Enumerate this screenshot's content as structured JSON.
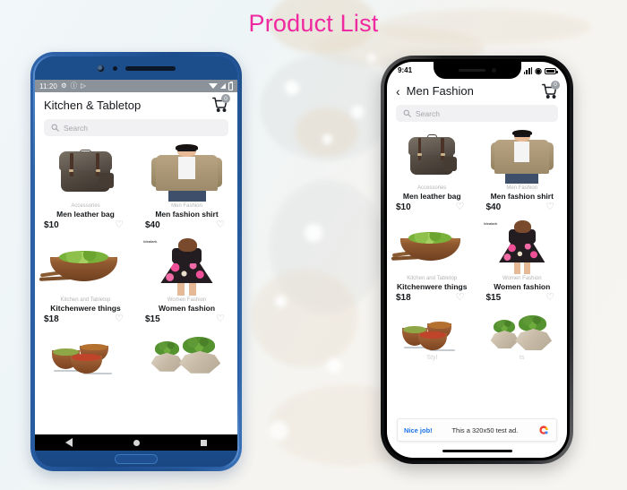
{
  "page": {
    "title": "Product List",
    "title_color": "#ef29a0"
  },
  "android": {
    "status_bar": {
      "time": "11:20",
      "icons": [
        "gear-icon",
        "info-icon",
        "play-icon"
      ],
      "right_icons": [
        "wifi-icon",
        "signal-icon",
        "battery-icon"
      ]
    },
    "app_bar": {
      "title": "Kitchen & Tabletop",
      "cart_icon": "shopping-cart-icon",
      "cart_badge": "0"
    },
    "search": {
      "placeholder": "Search",
      "icon": "search-icon"
    },
    "products": [
      {
        "category": "Accessories",
        "name": "Men leather bag",
        "price": "$10",
        "favorite_icon": "heart-outline-icon",
        "image": "leather-backpack"
      },
      {
        "category": "Men Fashion",
        "name": "Men fashion shirt",
        "price": "$40",
        "favorite_icon": "heart-outline-icon",
        "image": "man-in-khaki-shirt"
      },
      {
        "category": "Kitchen and Tabletop",
        "name": "Kitchenwere things",
        "price": "$18",
        "favorite_icon": "heart-outline-icon",
        "image": "wooden-salad-bowl"
      },
      {
        "category": "Women Fashion",
        "name": "Women fashion",
        "price": "$15",
        "favorite_icon": "heart-outline-icon",
        "image": "floral-dress",
        "watermark": "Idealark"
      },
      {
        "category": "",
        "name": "",
        "price": "",
        "favorite_icon": "",
        "image": "wooden-food-bowls"
      },
      {
        "category": "",
        "name": "",
        "price": "",
        "favorite_icon": "",
        "image": "stone-planters"
      }
    ],
    "nav_bar": {
      "back": "back-triangle-icon",
      "home": "home-circle-icon",
      "recents": "recents-square-icon"
    }
  },
  "iphone": {
    "status_bar": {
      "time": "9:41",
      "right_icons": [
        "cellular-signal-icon",
        "wifi-icon",
        "battery-icon"
      ]
    },
    "app_bar": {
      "back_icon": "chevron-left-icon",
      "title": "Men Fashion",
      "cart_icon": "shopping-cart-icon",
      "cart_badge": "0"
    },
    "search": {
      "placeholder": "Search",
      "icon": "search-icon"
    },
    "products": [
      {
        "category": "Accessories",
        "name": "Men leather bag",
        "price": "$10",
        "favorite_icon": "heart-outline-icon",
        "image": "leather-backpack"
      },
      {
        "category": "Men Fashion",
        "name": "Men fashion shirt",
        "price": "$40",
        "favorite_icon": "heart-outline-icon",
        "image": "man-in-khaki-shirt"
      },
      {
        "category": "Kitchen and Tabletop",
        "name": "Kitchenwere things",
        "price": "$18",
        "favorite_icon": "heart-outline-icon",
        "image": "wooden-salad-bowl"
      },
      {
        "category": "Women Fashion",
        "name": "Women fashion",
        "price": "$15",
        "favorite_icon": "heart-outline-icon",
        "image": "floral-dress",
        "watermark": "Idealark"
      },
      {
        "category": "",
        "name": "",
        "price": "",
        "favorite_icon": "",
        "image": "wooden-food-bowls"
      },
      {
        "category": "",
        "name": "",
        "price": "",
        "favorite_icon": "",
        "image": "stone-planters"
      }
    ],
    "partial_labels": {
      "left": "Styl",
      "right": "ts"
    },
    "ad_banner": {
      "cta": "Nice job!",
      "text": "This a 320x50 test ad.",
      "logo": "admob-logo"
    }
  }
}
